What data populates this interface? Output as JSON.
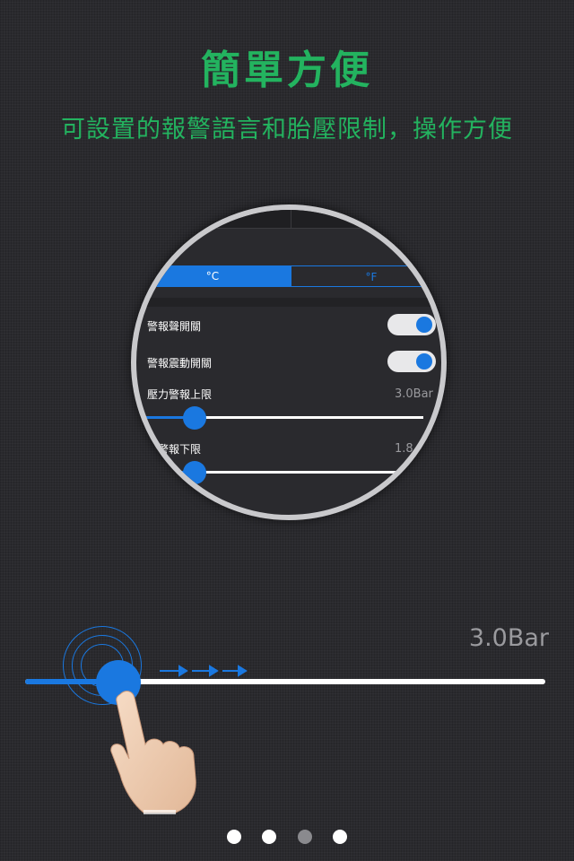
{
  "header": {
    "title": "簡單方便",
    "subtitle": "可設置的報警語言和胎壓限制，操作方便",
    "accent_color": "#23b35f"
  },
  "magnifier": {
    "unit_segment": {
      "options": [
        "°C",
        "°F"
      ],
      "selected": "°C"
    },
    "rows": {
      "alarm_sound": {
        "label": "警報聲開關",
        "on": true
      },
      "alarm_vibration": {
        "label": "警報震動開關",
        "on": true
      },
      "pressure_upper": {
        "label": "壓力警報上限",
        "value": "3.0Bar"
      },
      "pressure_lower": {
        "label": "力警報下限",
        "value": "1.8"
      }
    },
    "accent_color": "#1a78e0"
  },
  "demo_slider": {
    "value_label": "3.0Bar",
    "fill_fraction": 0.18,
    "icons": [
      "ripple-icon",
      "arrow-right-icon",
      "hand-pointer-icon"
    ]
  },
  "pager": {
    "total": 4,
    "active_index": 2,
    "active_color": "#8a8a8e",
    "inactive_color": "#ffffff"
  }
}
